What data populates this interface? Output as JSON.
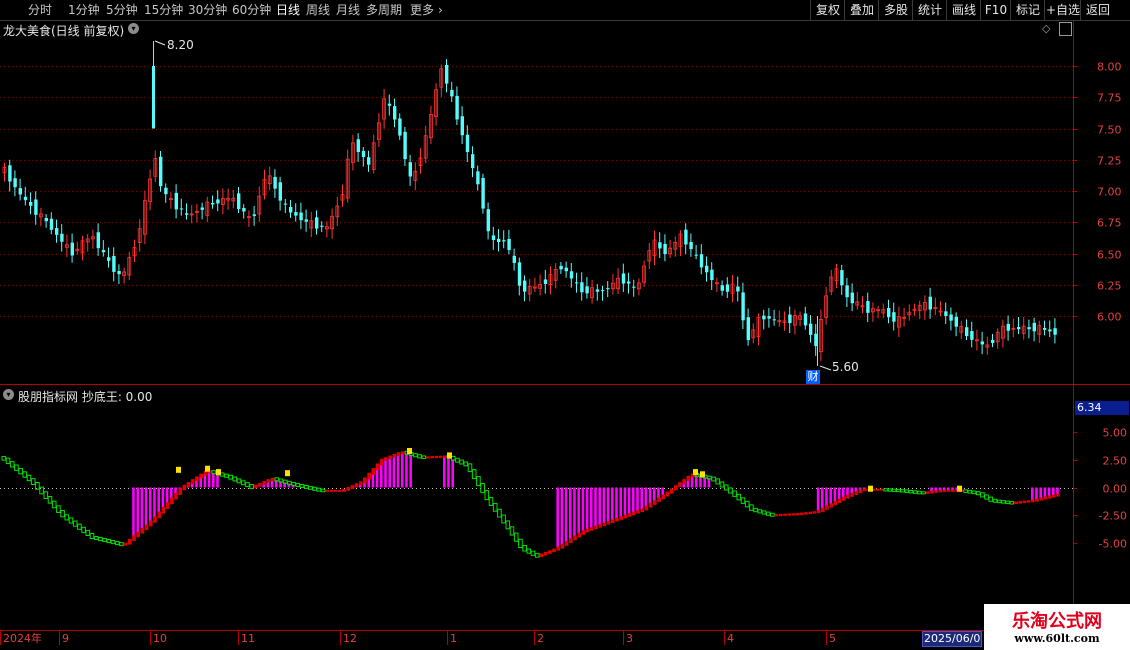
{
  "toolbar": {
    "periods": [
      "分时",
      "1分钟",
      "5分钟",
      "15分钟",
      "30分钟",
      "60分钟",
      "日线",
      "周线",
      "月线",
      "多周期",
      "更多"
    ],
    "active": "日线",
    "right": [
      "复权",
      "叠加",
      "多股",
      "统计",
      "画线",
      "F10",
      "标记",
      "+自选",
      "返回"
    ]
  },
  "price_panel": {
    "title": "龙大美食(日线 前复权)",
    "high_label": "8.20",
    "low_label": "5.60",
    "event_badge": "财"
  },
  "indicator_panel": {
    "title": "股朋指标网 抄底王: 0.00",
    "current_value": "6.34"
  },
  "date_tag": "2025/06/0",
  "watermark": {
    "line1": "乐淘公式网",
    "line2": "www.60lt.com"
  },
  "colors": {
    "up": "#ff3232",
    "down": "#54fcfc",
    "grid": "#7a0000",
    "axis": "#b40000",
    "green": "#00e000",
    "red": "#e00000",
    "magenta": "#ff00ff",
    "yellow": "#ffe000"
  },
  "chart_data": [
    {
      "type": "candlestick",
      "title": "龙大美食(日线 前复权)",
      "y_ticks": [
        8.0,
        7.75,
        7.5,
        7.25,
        7.0,
        6.75,
        6.5,
        6.25,
        6.0
      ],
      "ylim": [
        5.6,
        8.2
      ],
      "x_ticks": [
        "2024年",
        "9",
        "10",
        "11",
        "12",
        "1",
        "2",
        "3",
        "4",
        "5"
      ],
      "annotations": {
        "max": 8.2,
        "min": 5.6
      },
      "close_path": [
        [
          0,
          7.2
        ],
        [
          20,
          6.95
        ],
        [
          45,
          6.75
        ],
        [
          70,
          6.5
        ],
        [
          90,
          6.65
        ],
        [
          105,
          6.45
        ],
        [
          120,
          6.3
        ],
        [
          135,
          6.6
        ],
        [
          145,
          6.95
        ],
        [
          153,
          7.3
        ],
        [
          160,
          7.0
        ],
        [
          185,
          6.8
        ],
        [
          210,
          6.9
        ],
        [
          230,
          6.95
        ],
        [
          250,
          6.75
        ],
        [
          265,
          7.15
        ],
        [
          285,
          6.85
        ],
        [
          305,
          6.75
        ],
        [
          325,
          6.7
        ],
        [
          340,
          6.95
        ],
        [
          350,
          7.4
        ],
        [
          368,
          7.2
        ],
        [
          382,
          7.75
        ],
        [
          395,
          7.55
        ],
        [
          410,
          7.05
        ],
        [
          425,
          7.45
        ],
        [
          440,
          8.0
        ],
        [
          455,
          7.6
        ],
        [
          470,
          7.2
        ],
        [
          480,
          6.95
        ],
        [
          488,
          6.6
        ],
        [
          505,
          6.6
        ],
        [
          520,
          6.2
        ],
        [
          540,
          6.25
        ],
        [
          560,
          6.4
        ],
        [
          580,
          6.2
        ],
        [
          600,
          6.2
        ],
        [
          620,
          6.3
        ],
        [
          635,
          6.2
        ],
        [
          650,
          6.6
        ],
        [
          665,
          6.5
        ],
        [
          680,
          6.65
        ],
        [
          700,
          6.4
        ],
        [
          720,
          6.2
        ],
        [
          735,
          6.25
        ],
        [
          745,
          5.8
        ],
        [
          760,
          6.0
        ],
        [
          780,
          5.95
        ],
        [
          800,
          6.0
        ],
        [
          815,
          5.75
        ],
        [
          825,
          6.2
        ],
        [
          833,
          6.4
        ],
        [
          845,
          6.15
        ],
        [
          865,
          6.05
        ],
        [
          880,
          6.05
        ],
        [
          895,
          5.95
        ],
        [
          910,
          6.05
        ],
        [
          925,
          6.1
        ],
        [
          945,
          6.0
        ],
        [
          965,
          5.85
        ],
        [
          985,
          5.75
        ],
        [
          1000,
          5.9
        ],
        [
          1020,
          5.9
        ],
        [
          1040,
          5.9
        ],
        [
          1058,
          5.85
        ]
      ]
    },
    {
      "type": "bar",
      "title": "股朋指标网 抄底王",
      "y_ticks": [
        5.0,
        2.5,
        0.0,
        -2.5,
        -5.0
      ],
      "ylim": [
        -6.3,
        3.8
      ],
      "line_path": [
        [
          0,
          2.7
        ],
        [
          30,
          0.5
        ],
        [
          60,
          -2.5
        ],
        [
          90,
          -4.5
        ],
        [
          122,
          -5.2
        ],
        [
          150,
          -3.0
        ],
        [
          180,
          0.0
        ],
        [
          205,
          1.5
        ],
        [
          225,
          1.0
        ],
        [
          250,
          0.0
        ],
        [
          270,
          0.8
        ],
        [
          290,
          0.3
        ],
        [
          320,
          -0.3
        ],
        [
          340,
          -0.3
        ],
        [
          360,
          0.5
        ],
        [
          380,
          2.5
        ],
        [
          400,
          3.2
        ],
        [
          420,
          2.7
        ],
        [
          445,
          2.8
        ],
        [
          465,
          2.0
        ],
        [
          485,
          -1.0
        ],
        [
          505,
          -3.5
        ],
        [
          520,
          -5.5
        ],
        [
          535,
          -6.2
        ],
        [
          555,
          -5.5
        ],
        [
          580,
          -4.0
        ],
        [
          610,
          -3.0
        ],
        [
          640,
          -2.0
        ],
        [
          665,
          -0.5
        ],
        [
          690,
          1.2
        ],
        [
          710,
          0.8
        ],
        [
          730,
          -0.5
        ],
        [
          750,
          -2.0
        ],
        [
          770,
          -2.5
        ],
        [
          795,
          -2.4
        ],
        [
          815,
          -2.2
        ],
        [
          840,
          -1.0
        ],
        [
          860,
          -0.2
        ],
        [
          880,
          -0.2
        ],
        [
          900,
          -0.3
        ],
        [
          920,
          -0.5
        ],
        [
          940,
          -0.3
        ],
        [
          960,
          -0.3
        ],
        [
          975,
          -0.5
        ],
        [
          990,
          -1.2
        ],
        [
          1010,
          -1.4
        ],
        [
          1030,
          -1.2
        ],
        [
          1058,
          -0.6
        ]
      ],
      "magenta_ranges": [
        [
          130,
          220
        ],
        [
          262,
          292
        ],
        [
          350,
          410
        ],
        [
          440,
          452
        ],
        [
          555,
          665
        ],
        [
          680,
          710
        ],
        [
          813,
          867
        ],
        [
          930,
          960
        ],
        [
          1027,
          1058
        ]
      ]
    }
  ]
}
